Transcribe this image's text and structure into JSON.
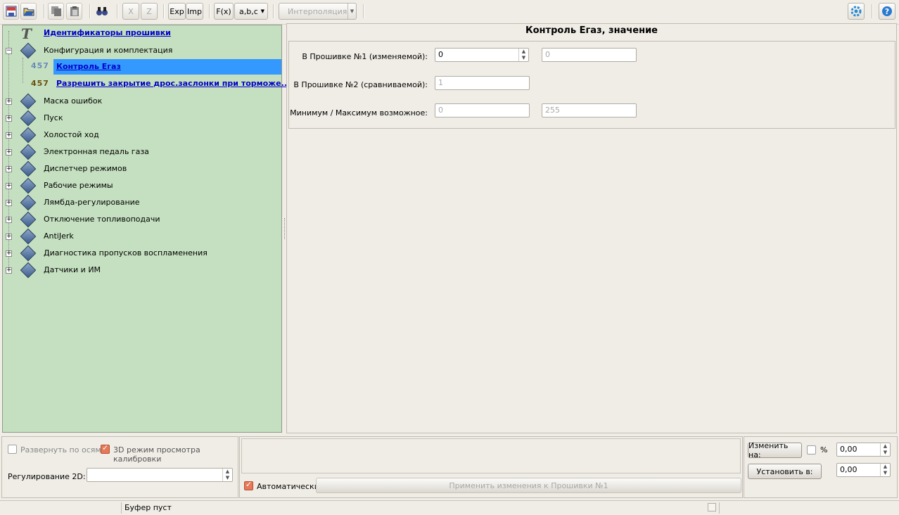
{
  "toolbar": {
    "exp_label": "Exp",
    "imp_label": "Imp",
    "x_label": "X",
    "z_label": "Z",
    "fx_label": "F(x)",
    "abc_label": "a,b,c",
    "interp_label": "Интерполяция"
  },
  "tree": {
    "items": [
      {
        "label": "Идентификаторы прошивки"
      },
      {
        "label": "Конфигурация и комплектация"
      },
      {
        "label": "Контроль Егаз"
      },
      {
        "label": "Разрешить закрытие дрос.заслонки при торможе..."
      },
      {
        "label": "Маска ошибок"
      },
      {
        "label": "Пуск"
      },
      {
        "label": "Холостой ход"
      },
      {
        "label": "Электронная педаль газа"
      },
      {
        "label": "Диспетчер режимов"
      },
      {
        "label": "Рабочие режимы"
      },
      {
        "label": "Лямбда-регулирование"
      },
      {
        "label": "Отключение топливоподачи"
      },
      {
        "label": "AntiJerk"
      },
      {
        "label": "Диагностика пропусков воспламенения"
      },
      {
        "label": "Датчики и ИМ"
      }
    ],
    "num_icon_text": "457"
  },
  "panel": {
    "title": "Контроль Егаз, значение",
    "fw1_label": "В Прошивке №1 (изменяемой):",
    "fw1_value": "0",
    "fw1_compare": "0",
    "fw2_label": "В Прошивке №2 (сравниваемой):",
    "fw2_value": "1",
    "minmax_label": "Минимум / Максимум возможное:",
    "min_value": "0",
    "max_value": "255"
  },
  "bottom": {
    "expand_axes": "Развернуть по осям",
    "mode3d": "3D режим просмотра калибровки",
    "reg2d_label": "Регулирование 2D:",
    "auto_label": "Автоматически",
    "apply_label": "Применить изменения к Прошивки №1",
    "change_by": "Изменить на:",
    "percent": "%",
    "change_value": "0,00",
    "set_to": "Установить в:",
    "set_value": "0,00"
  },
  "status": {
    "buffer": "Буфер пуст"
  },
  "colors": {
    "tree_bg": "#c5e0c0",
    "selection": "#3399ff",
    "link": "#0000c8"
  }
}
